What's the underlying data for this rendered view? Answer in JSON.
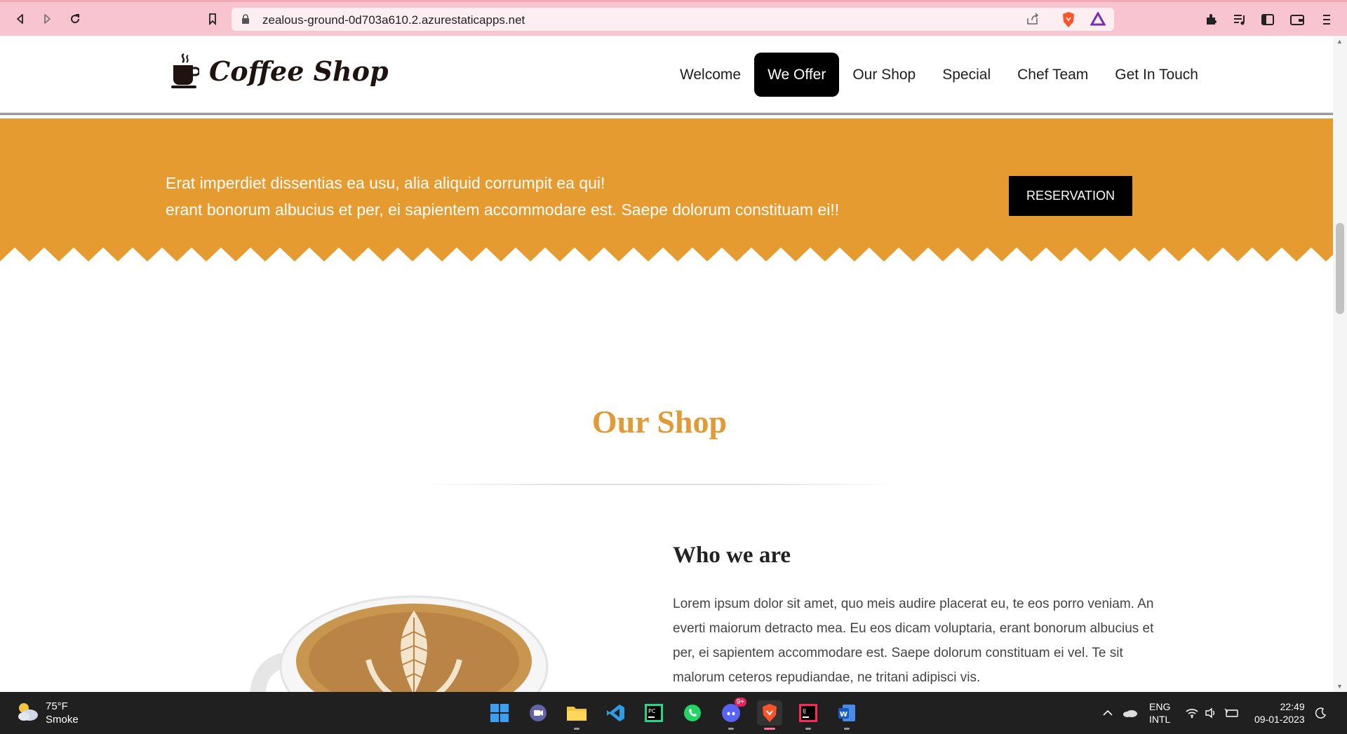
{
  "browser": {
    "url": "zealous-ground-0d703a610.2.azurestaticapps.net"
  },
  "site": {
    "logo_text": "Coffee Shop",
    "nav": [
      {
        "label": "Welcome"
      },
      {
        "label": "We Offer",
        "active": true
      },
      {
        "label": "Our Shop"
      },
      {
        "label": "Special"
      },
      {
        "label": "Chef Team"
      },
      {
        "label": "Get In Touch"
      }
    ]
  },
  "banner": {
    "line1": "Erat imperdiet dissentias ea usu, alia aliquid corrumpit ea qui!",
    "line2": "erant bonorum albucius et per, ei sapientem accommodare est. Saepe dolorum constituam ei!!",
    "button": "RESERVATION",
    "color": "#e69b30"
  },
  "our_shop": {
    "title": "Our Shop",
    "title_color": "#e09a36",
    "subtitle": "Who we are",
    "body": "Lorem ipsum dolor sit amet, quo meis audire placerat eu, te eos porro veniam. An everti maiorum detracto mea. Eu eos dicam voluptaria, erant bonorum albucius et per, ei sapientem accommodare est. Saepe dolorum constituam ei vel. Te sit malorum ceteros repudiandae, ne tritani adipisci vis."
  },
  "taskbar": {
    "weather_temp": "75°F",
    "weather_desc": "Smoke",
    "discord_badge": "9+",
    "lang_line1": "ENG",
    "lang_line2": "INTL",
    "time": "22:49",
    "date": "09-01-2023"
  }
}
